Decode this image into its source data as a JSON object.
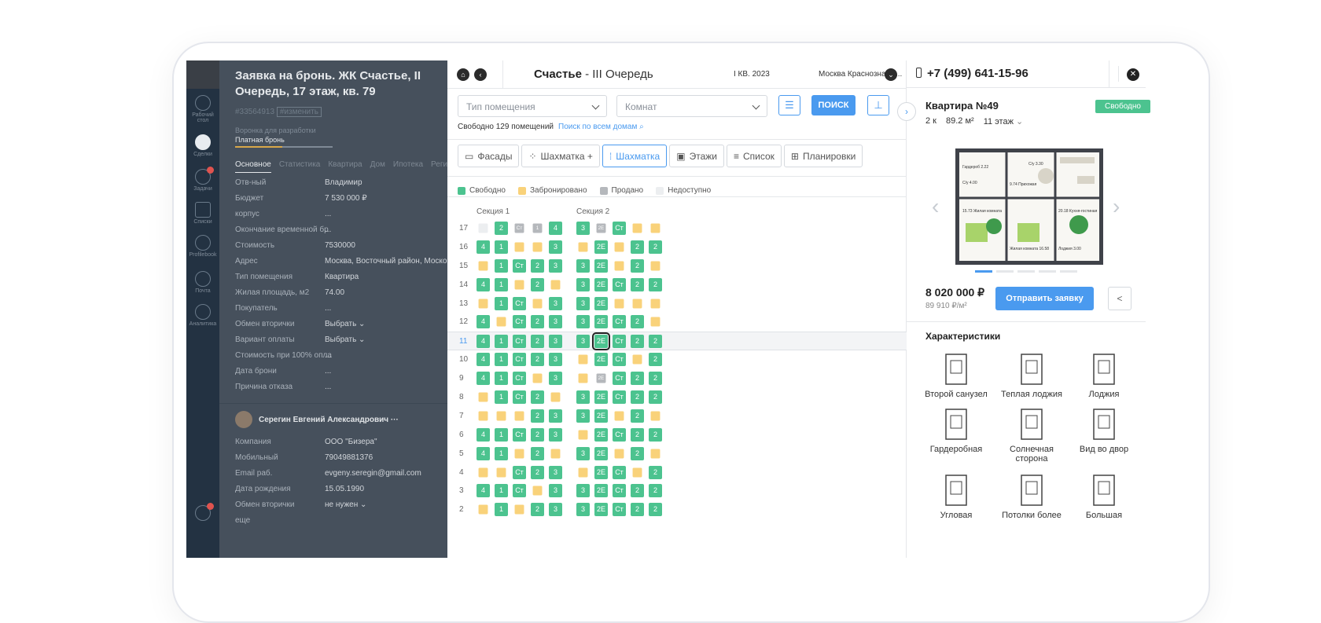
{
  "crm": {
    "title": "Заявка на бронь. ЖК Счастье, II Очередь, 17 этаж, кв. 79",
    "id": "#33564913",
    "id_tag": "#изменить",
    "pipeline": "Воронка для разработки",
    "stage": "Платная бронь",
    "tabs": [
      "Основное",
      "Статистика",
      "Квартира",
      "Дом",
      "Ипотека",
      "Регистр"
    ],
    "rail": [
      "Рабочий стол",
      "Сделки",
      "Задачи",
      "Списки",
      "Profilebook",
      "Почта",
      "Аналитика"
    ],
    "fields": [
      {
        "k": "Отв-ный",
        "v": "Владимир"
      },
      {
        "k": "Бюджет",
        "v": "7 530 000 ₽"
      },
      {
        "k": "корпус",
        "v": "..."
      },
      {
        "k": "Окончание временной бр",
        "v": "..."
      },
      {
        "k": "Стоимость",
        "v": "7530000"
      },
      {
        "k": "Адрес",
        "v": "Москва, Восточный район, Москов"
      },
      {
        "k": "Тип помещения",
        "v": "Квартира"
      },
      {
        "k": "Жилая площадь, м2",
        "v": "74.00"
      },
      {
        "k": "Покупатель",
        "v": "..."
      },
      {
        "k": "Обмен вторички",
        "v": "Выбрать ⌄"
      },
      {
        "k": "Вариант оплаты",
        "v": "Выбрать ⌄"
      },
      {
        "k": "Стоимость при 100% опла",
        "v": "..."
      },
      {
        "k": "Дата брони",
        "v": "..."
      },
      {
        "k": "Причина отказа",
        "v": "..."
      }
    ],
    "contact_name": "Серегин Евгений Александрович",
    "contact_fields": [
      {
        "k": "Компания",
        "v": "ООО \"Бизера\""
      },
      {
        "k": "Мобильный",
        "v": "79049881376"
      },
      {
        "k": "Email раб.",
        "v": "evgeny.seregin@gmail.com"
      },
      {
        "k": "Дата рождения",
        "v": "15.05.1990"
      },
      {
        "k": "Обмен вторички",
        "v": "не нужен ⌄"
      },
      {
        "k": "еще",
        "v": ""
      }
    ]
  },
  "sh": {
    "title_bold": "Счастье",
    "title_rest": " - III Очередь",
    "quarter": "I КВ. 2023",
    "city": "Москва Краснознаме...",
    "type_placeholder": "Тип помещения",
    "rooms_placeholder": "Комнат",
    "search": "ПОИСК",
    "free_info": "Свободно 129 помещений",
    "search_all": "Поиск по всем домам",
    "views": [
      "Фасады",
      "Шахматка +",
      "Шахматка",
      "Этажи",
      "Список",
      "Планировки"
    ],
    "legend": [
      "Свободно",
      "Забронировано",
      "Продано",
      "Недоступно"
    ],
    "colors": {
      "free": "#4cc38f",
      "booked": "#f9d27a",
      "sold": "#b5b8bc",
      "na": "#eceef0",
      "accent": "#4a9aef"
    },
    "sections": [
      "Секция 1",
      "Секция 2"
    ],
    "floors": [
      {
        "n": "17",
        "c": [
          "n",
          "f2",
          "sСт",
          "s1",
          "f4",
          "f3",
          "s2Е",
          "fСт",
          "b",
          "b"
        ]
      },
      {
        "n": "16",
        "c": [
          "f4",
          "f1",
          "b",
          "b",
          "f3",
          "b",
          "f2Е",
          "b",
          "f2",
          "f2"
        ]
      },
      {
        "n": "15",
        "c": [
          "b",
          "f1",
          "fСт",
          "f2",
          "f3",
          "f3",
          "f2Е",
          "b",
          "f2",
          "b"
        ]
      },
      {
        "n": "14",
        "c": [
          "f4",
          "f1",
          "b",
          "f2",
          "b",
          "f3",
          "f2Е",
          "fСт",
          "f2",
          "f2"
        ]
      },
      {
        "n": "13",
        "c": [
          "b",
          "f1",
          "fСт",
          "b",
          "f3",
          "f3",
          "f2Е",
          "b",
          "b",
          "b"
        ]
      },
      {
        "n": "12",
        "c": [
          "f4",
          "b",
          "fСт",
          "f2",
          "f3",
          "f3",
          "f2Е",
          "fСт",
          "f2",
          "b"
        ]
      },
      {
        "n": "11",
        "c": [
          "f4",
          "f1",
          "fСт",
          "f2",
          "f3",
          "f3",
          "f2Е",
          "fСт",
          "f2",
          "f2"
        ]
      },
      {
        "n": "10",
        "c": [
          "f4",
          "f1",
          "fСт",
          "f2",
          "f3",
          "b",
          "f2Е",
          "fСт",
          "b",
          "f2"
        ]
      },
      {
        "n": "9",
        "c": [
          "f4",
          "f1",
          "fСт",
          "b",
          "f3",
          "b",
          "s2Е",
          "fСт",
          "f2",
          "f2"
        ]
      },
      {
        "n": "8",
        "c": [
          "b",
          "f1",
          "fСт",
          "f2",
          "b",
          "f3",
          "f2Е",
          "fСт",
          "f2",
          "f2"
        ]
      },
      {
        "n": "7",
        "c": [
          "b",
          "b",
          "b",
          "f2",
          "f3",
          "f3",
          "f2Е",
          "b",
          "f2",
          "b"
        ]
      },
      {
        "n": "6",
        "c": [
          "f4",
          "f1",
          "fСт",
          "f2",
          "f3",
          "b",
          "f2Е",
          "fСт",
          "f2",
          "f2"
        ]
      },
      {
        "n": "5",
        "c": [
          "f4",
          "f1",
          "b",
          "f2",
          "b",
          "f3",
          "f2Е",
          "b",
          "f2",
          "b"
        ]
      },
      {
        "n": "4",
        "c": [
          "b",
          "b",
          "fСт",
          "f2",
          "f3",
          "b",
          "f2Е",
          "fСт",
          "b",
          "f2"
        ]
      },
      {
        "n": "3",
        "c": [
          "f4",
          "f1",
          "fСт",
          "b",
          "f3",
          "f3",
          "f2Е",
          "fСт",
          "f2",
          "f2"
        ]
      },
      {
        "n": "2",
        "c": [
          "b",
          "f1",
          "b",
          "f2",
          "f3",
          "f3",
          "f2Е",
          "fСт",
          "f2",
          "f2"
        ]
      }
    ]
  },
  "rp": {
    "phone": "+7 (499) 641-15-96",
    "flat": "Квартира №49",
    "status": "Свободно",
    "rooms": "2 к",
    "area": "89.2 м²",
    "floor": "11 этаж",
    "price": "8 020 000 ₽",
    "ppm": "89 910 ₽/м²",
    "send": "Отправить заявку",
    "char_title": "Характеристики",
    "features": [
      "Второй санузел",
      "Теплая лоджия",
      "Лоджия",
      "Гардеробная",
      "Солнечная сторона",
      "Вид во двор",
      "Угловая",
      "Потолки более",
      "Большая"
    ],
    "plan_labels": [
      "Гардероб 2.22",
      "С/у 4.00",
      "9.74 Прихожая",
      "С/у 3.30",
      "15.73 Жилая комната",
      "20.18 Кухня-гостиная",
      "Жилая комната 16.58",
      "Лоджия 3.00"
    ]
  }
}
